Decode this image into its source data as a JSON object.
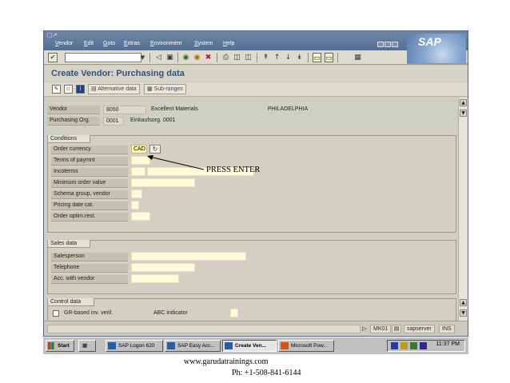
{
  "menu": {
    "items": [
      "Vendor",
      "Edit",
      "Goto",
      "Extras",
      "Environment",
      "System",
      "Help"
    ]
  },
  "brand": {
    "logo_text": "SAP"
  },
  "toolbar": {
    "icons": [
      "enter-icon",
      "command-dropdown-icon",
      "back-icon",
      "save-icon",
      "exit-icon",
      "cancel-icon",
      "print-icon",
      "find-icon",
      "find-next-icon",
      "first-page-icon",
      "previous-page-icon",
      "next-page-icon",
      "last-page-icon",
      "new-session-icon",
      "shortcut-icon",
      "help-icon",
      "layout-menu-icon"
    ]
  },
  "title": "Create Vendor: Purchasing data",
  "app_toolbar": {
    "alternative_data": "Alternative data",
    "sub_ranges": "Sub-ranges"
  },
  "header": {
    "vendor_label": "Vendor",
    "vendor_number": "8050",
    "vendor_name": "Excellent Materials",
    "vendor_city": "PHILADELPHIA",
    "purch_org_label": "Purchasing Org.",
    "purch_org_number": "0001",
    "purch_org_name": "Einkaufsorg. 0001"
  },
  "conditions": {
    "title": "Conditions",
    "order_currency_label": "Order currency",
    "order_currency_value": "CAD",
    "terms_label": "Terms of paymnt",
    "incoterms_label": "Incoterms",
    "min_order_label": "Minimum order value",
    "schema_group_label": "Schema group, vendor",
    "pricing_date_label": "Pricing date cat.",
    "order_optim_label": "Order optim.rest."
  },
  "sales": {
    "title": "Sales data",
    "salesperson_label": "Salesperson",
    "telephone_label": "Telephone",
    "acc_vendor_label": "Acc. with vendor"
  },
  "control": {
    "title": "Control data",
    "gr_based_label": "GR-based inv. verif.",
    "abc_label": "ABC indicator"
  },
  "status": {
    "client": "MK01",
    "server": "sapserver",
    "mode": "INS"
  },
  "taskbar": {
    "start": "Start",
    "tasks": [
      "SAP Logon 620",
      "SAP Easy Acc...",
      "Create Ven...",
      "Microsoft Pow..."
    ],
    "clock": "11:37 PM"
  },
  "annotation": "PRESS ENTER",
  "footer": {
    "url": "www.garudatrainings.com",
    "phone": "Ph: +1-508-841-6144"
  },
  "colors": {
    "title_blue": "#32507e",
    "required_field": "#fff6b0",
    "input_field": "#fffbd8",
    "menubar": "#6e86a7"
  }
}
